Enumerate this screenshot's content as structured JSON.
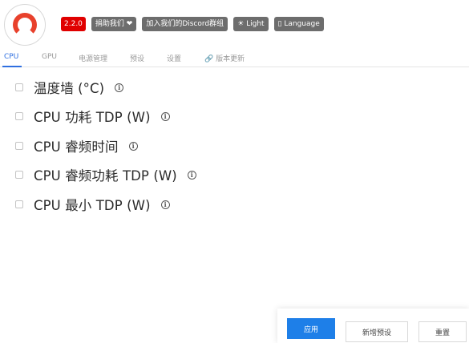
{
  "header": {
    "version": "2.2.0",
    "donate_label": "捐助我们 ❤",
    "discord_label": "加入我们的Discord群组",
    "theme_label": "☀ Light",
    "language_label": "▯ Language"
  },
  "tabs": [
    {
      "label": "CPU",
      "active": true
    },
    {
      "label": "GPU",
      "active": false
    },
    {
      "label": "电源管理",
      "active": false
    },
    {
      "label": "预设",
      "active": false
    },
    {
      "label": "设置",
      "active": false
    },
    {
      "label": "🔗 版本更新",
      "active": false
    }
  ],
  "settings": [
    {
      "label": "温度墙 (°C)"
    },
    {
      "label": "CPU 功耗 TDP (W)"
    },
    {
      "label": "CPU 睿频时间"
    },
    {
      "label": "CPU 睿频功耗 TDP (W)"
    },
    {
      "label": "CPU 最小 TDP (W)"
    }
  ],
  "info_glyph": "i",
  "actions": {
    "apply_label": "应用",
    "save_preset_label": "新增预设",
    "reset_label": "重置"
  },
  "colors": {
    "accent": "#1e7fe8",
    "version_badge": "#e00000",
    "logo": "#e8412c"
  }
}
